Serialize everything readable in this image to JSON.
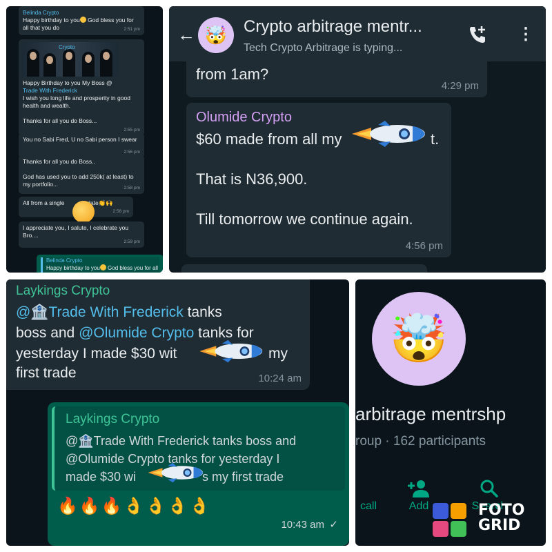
{
  "tile1": {
    "msg1": {
      "sender": "Belinda Crypto",
      "text_a": "Happy birthday to you",
      "text_b": " God bless you for all that you do",
      "time": "2:51 pm"
    },
    "img_sender": "Crypto",
    "msg2": {
      "text_a": "Happy Birthday to you My Boss @",
      "mention": "Trade With Frederick",
      "text_b": "I wish you long life and prosperity in good health and wealth.",
      "text_c": "Thanks for all you do Boss...",
      "time": "2:55 pm"
    },
    "msg3": {
      "text": "You no Sabi Fred, U no Sabi person I swear",
      "time": "2:56 pm"
    },
    "msg4": {
      "text_a": "Thanks for all you do Boss..",
      "text_b": "God has used you to add 250k( at least) to my portfolio...",
      "time": "2:58 pm"
    },
    "msg5": {
      "text_a": "All from a single",
      "text_b": "date",
      "emoji": "👏🙌",
      "time": "2:58 pm"
    },
    "msg6": {
      "text": "I appreciate you, I salute, I celebrate you Bro....",
      "time": "2:59 pm"
    },
    "reply": {
      "sender": "Belinda Crypto",
      "text_a": "Happy birthday to you",
      "text_b": " God bless you for all that you do"
    }
  },
  "tile2": {
    "title": "Crypto arbitrage mentr...",
    "subtitle": "Tech Crypto Arbitrage is typing...",
    "prev_msg": {
      "text": "from 1am?",
      "time": "4:29 pm"
    },
    "msg": {
      "sender": "Olumide Crypto",
      "line1_a": "$60 made from all my",
      "line1_b": "t.",
      "line2": "That is N36,900.",
      "line3": "Till tomorrow we continue again.",
      "time": "4:56 pm"
    },
    "avatar_emoji": "🤯"
  },
  "tile3": {
    "msg": {
      "sender": "Laykings Crypto",
      "mention1": "@🏦Trade With Frederick",
      "t1": " tanks",
      "t2": "boss and ",
      "mention2": "@Olumide Crypto",
      "t3": " tanks for",
      "t4": "yesterday I made $30 wit",
      "t5": "my",
      "t6": "first trade",
      "time": "10:24 am"
    },
    "reply": {
      "quote_sender": "Laykings Crypto",
      "q1": "@🏦Trade With Frederick tanks boss and",
      "q2": "@Olumide Crypto tanks for yesterday I",
      "q3_a": "made $30 wi",
      "q3_b": "s my first trade",
      "emojis": "🔥🔥🔥👌👌👌👌",
      "time": "10:43 am",
      "status": "✓"
    }
  },
  "tile4": {
    "avatar_emoji": "🤯",
    "title": "arbitrage mentrshp",
    "subtitle": "roup · 162 participants",
    "actions": [
      "call",
      "Add",
      "Search"
    ],
    "watermark": "FOTO GRID"
  },
  "colors": {
    "chat_bg": "#0b141a",
    "bubble_in": "#202c33",
    "bubble_out": "#005c4b",
    "accent": "#00a884",
    "mention": "#53bdeb",
    "avatar_bg": "#ddc4f4"
  }
}
